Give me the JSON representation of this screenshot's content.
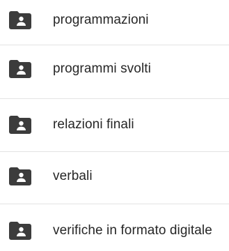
{
  "folders": [
    {
      "label": "programmazioni",
      "icon": "shared-folder-icon"
    },
    {
      "label": "programmi svolti",
      "icon": "shared-folder-icon"
    },
    {
      "label": "relazioni finali",
      "icon": "shared-folder-icon"
    },
    {
      "label": "verbali",
      "icon": "shared-folder-icon"
    },
    {
      "label": "verifiche in formato digitale",
      "icon": "shared-folder-icon"
    }
  ],
  "colors": {
    "icon": "#3c3c3c",
    "text": "#262626",
    "divider": "#e3e3e3",
    "background": "#ffffff"
  }
}
